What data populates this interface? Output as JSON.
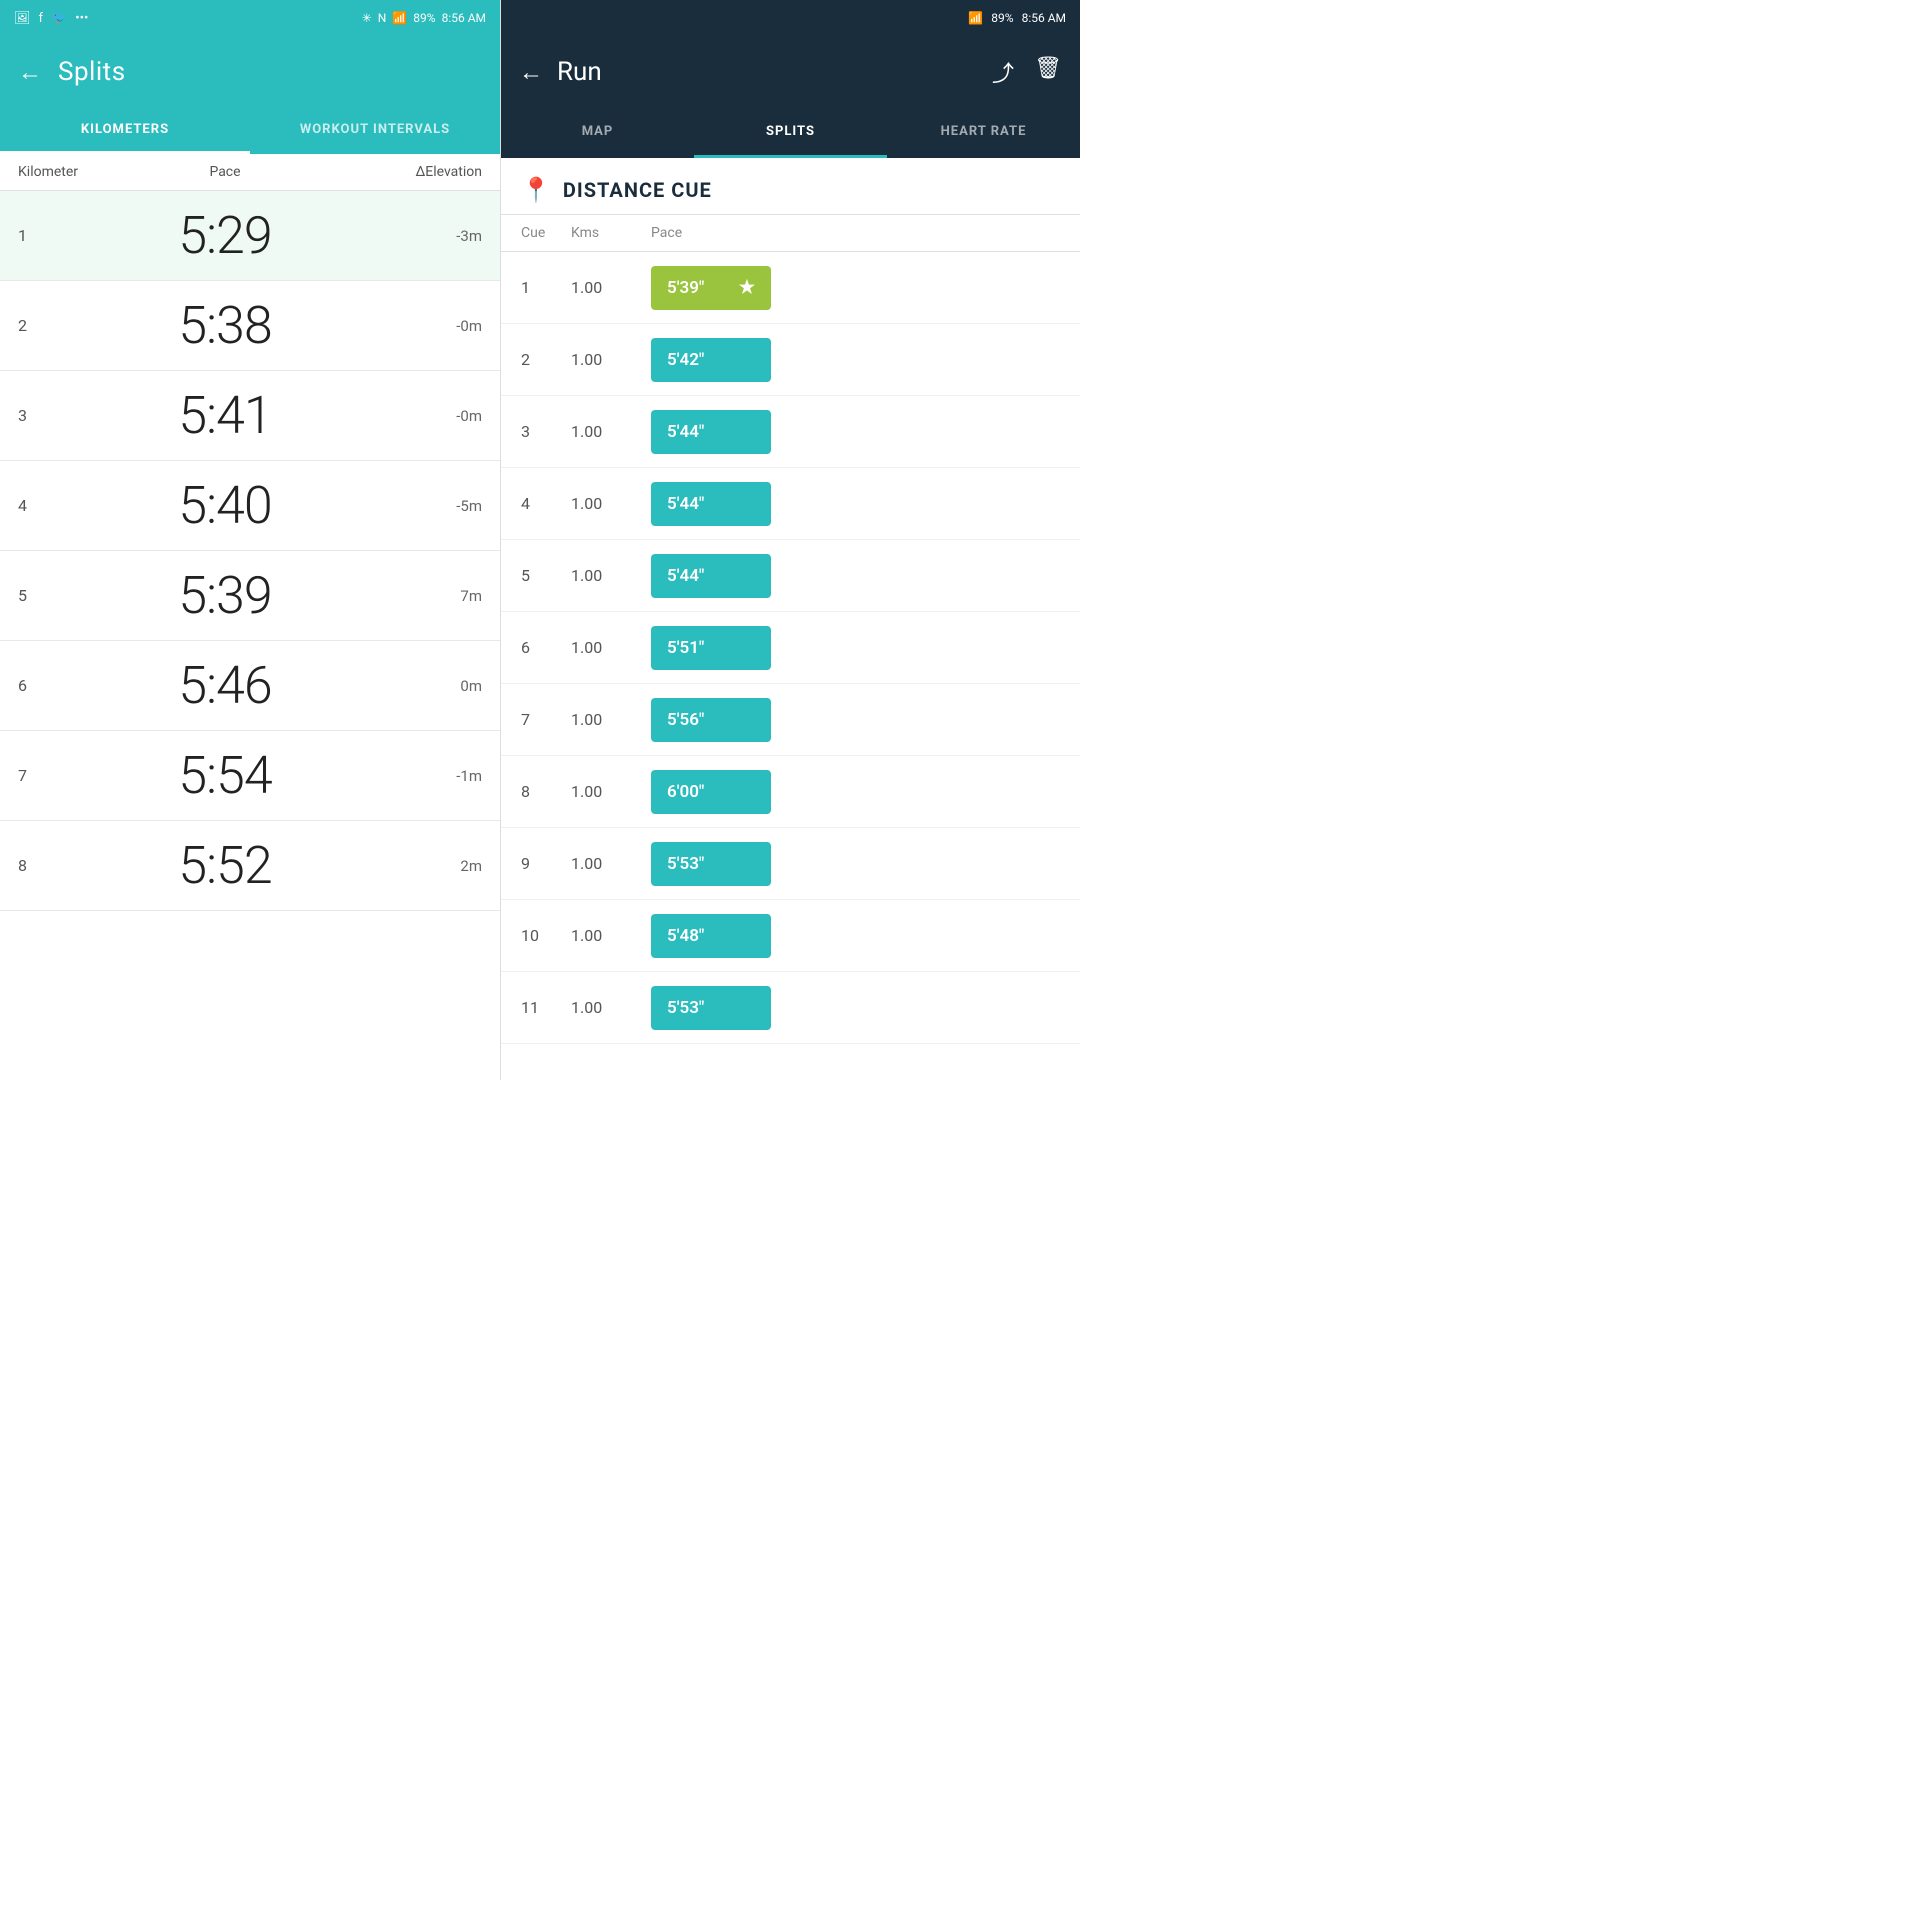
{
  "left": {
    "statusBar": {
      "icons": [
        "photo",
        "facebook",
        "twitter",
        "more"
      ],
      "right": [
        "bluetooth",
        "nfc",
        "wifi",
        "signal",
        "89%",
        "8:56 AM"
      ]
    },
    "header": {
      "back": "←",
      "title": "Splits"
    },
    "tabs": [
      {
        "id": "kilometers",
        "label": "KILOMETERS",
        "active": true
      },
      {
        "id": "workout",
        "label": "WORKOUT INTERVALS",
        "active": false
      }
    ],
    "columns": {
      "kilometer": "Kilometer",
      "pace": "Pace",
      "elevation": "ΔElevation"
    },
    "rows": [
      {
        "num": "1",
        "pace": "5:29",
        "elev": "-3m",
        "highlight": true
      },
      {
        "num": "2",
        "pace": "5:38",
        "elev": "-0m",
        "highlight": false
      },
      {
        "num": "3",
        "pace": "5:41",
        "elev": "-0m",
        "highlight": false
      },
      {
        "num": "4",
        "pace": "5:40",
        "elev": "-5m",
        "highlight": false
      },
      {
        "num": "5",
        "pace": "5:39",
        "elev": "7m",
        "highlight": false
      },
      {
        "num": "6",
        "pace": "5:46",
        "elev": "0m",
        "highlight": false
      },
      {
        "num": "7",
        "pace": "5:54",
        "elev": "-1m",
        "highlight": false
      },
      {
        "num": "8",
        "pace": "5:52",
        "elev": "2m",
        "highlight": false
      }
    ]
  },
  "right": {
    "statusBar": {
      "right": [
        "signal",
        "wifi",
        "89%",
        "8:56 AM"
      ]
    },
    "header": {
      "back": "←",
      "title": "Run",
      "share": "⤴",
      "trash": "🗑"
    },
    "tabs": [
      {
        "id": "map",
        "label": "MAP",
        "active": false
      },
      {
        "id": "splits",
        "label": "SPLITS",
        "active": true
      },
      {
        "id": "heartrate",
        "label": "HEART RATE",
        "active": false
      }
    ],
    "distanceCue": {
      "icon": "📍",
      "title": "DISTANCE CUE"
    },
    "columns": {
      "cue": "Cue",
      "kms": "Kms",
      "pace": "Pace"
    },
    "rows": [
      {
        "num": "1",
        "kms": "1.00",
        "pace": "5'39\"",
        "best": true
      },
      {
        "num": "2",
        "kms": "1.00",
        "pace": "5'42\"",
        "best": false
      },
      {
        "num": "3",
        "kms": "1.00",
        "pace": "5'44\"",
        "best": false
      },
      {
        "num": "4",
        "kms": "1.00",
        "pace": "5'44\"",
        "best": false
      },
      {
        "num": "5",
        "kms": "1.00",
        "pace": "5'44\"",
        "best": false
      },
      {
        "num": "6",
        "kms": "1.00",
        "pace": "5'51\"",
        "best": false
      },
      {
        "num": "7",
        "kms": "1.00",
        "pace": "5'56\"",
        "best": false
      },
      {
        "num": "8",
        "kms": "1.00",
        "pace": "6'00\"",
        "best": false
      },
      {
        "num": "9",
        "kms": "1.00",
        "pace": "5'53\"",
        "best": false
      },
      {
        "num": "10",
        "kms": "1.00",
        "pace": "5'48\"",
        "best": false
      },
      {
        "num": "11",
        "kms": "1.00",
        "pace": "5'53\"",
        "best": false
      }
    ]
  }
}
